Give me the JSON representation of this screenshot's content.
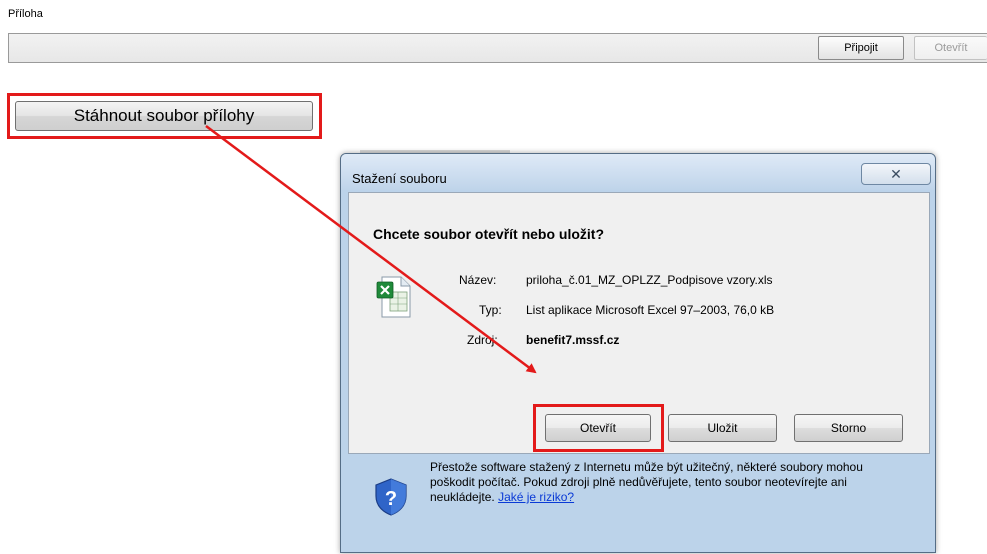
{
  "attachment": {
    "label": "Příloha",
    "attach_label": "Připojit",
    "open_label": "Otevřít"
  },
  "download_button_label": "Stáhnout soubor přílohy",
  "dialog": {
    "title": "Stažení souboru",
    "close_glyph": "✕",
    "question": "Chcete soubor otevřít nebo uložit?",
    "name_label": "Název:",
    "name_value": "priloha_č.01_MZ_OPLZZ_Podpisove vzory.xls",
    "type_label": "Typ:",
    "type_value": "List aplikace Microsoft Excel 97–2003, 76,0 kB",
    "source_label": "Zdroj:",
    "source_value": "benefit7.mssf.cz",
    "buttons": {
      "open": "Otevřít",
      "save": "Uložit",
      "cancel": "Storno"
    },
    "warning": {
      "text": "Přestože software stažený z Internetu může být užitečný, některé soubory mohou poškodit počítač. Pokud zdroji plně nedůvěřujete, tento soubor neotevírejte ani neukládejte.",
      "link": "Jaké je riziko?"
    }
  },
  "colors": {
    "highlight": "#e31a1a",
    "dialog_frame": "#bcd3ea",
    "link": "#0a3ad6"
  },
  "icons": {
    "file": "excel-file-icon",
    "shield": "security-shield-icon",
    "close": "close-icon"
  }
}
